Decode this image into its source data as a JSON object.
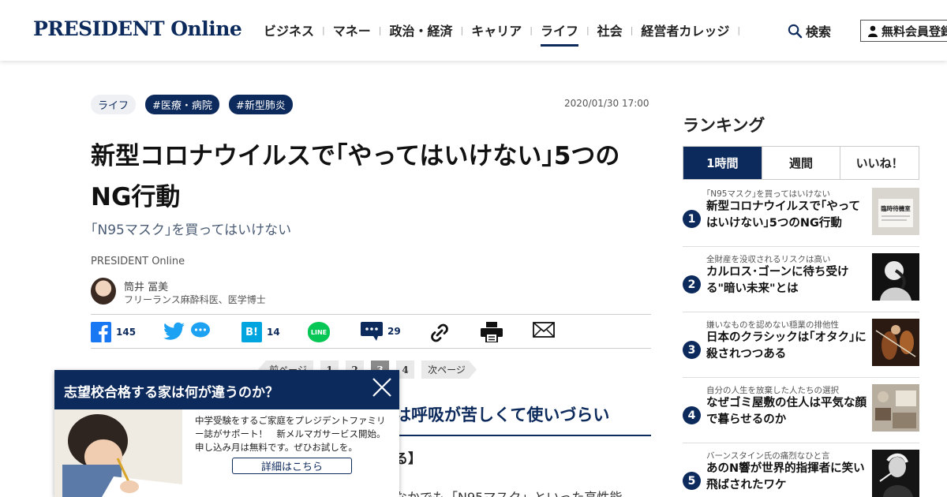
{
  "header": {
    "logo": "PRESIDENT Online",
    "nav": [
      "ビジネス",
      "マネー",
      "政治・経済",
      "キャリア",
      "ライフ",
      "社会",
      "経営者カレッジ"
    ],
    "nav_active": "ライフ",
    "search_label": "検索",
    "member_label": "無料会員登録"
  },
  "article": {
    "tags": [
      "ライフ",
      "#医療・病院",
      "#新型肺炎"
    ],
    "date": "2020/01/30 17:00",
    "title": "新型コロナウイルスで｢やってはいけない｣5つのNG行動",
    "subtitle": "｢N95マスク｣を買ってはいけない",
    "source": "PRESIDENT Online",
    "author_name": "筒井 冨美",
    "author_role": "フリーランス麻酔科医、医学博士",
    "share": {
      "facebook_count": "145",
      "hatena_count": "14",
      "comment_count": "29",
      "hatena_label": "B!",
      "line_label": "LINE"
    },
    "pager": {
      "prev": "前ページ",
      "pages": [
        "1",
        "2",
        "3",
        "4"
      ],
      "current": "3",
      "next": "次ページ"
    },
    "section_heading_visible": "は呼吸が苦しくて使いづらい",
    "sub_heading_visible": "る】",
    "body_snippet_visible": "なかでも「N95マスク」といった高性能"
  },
  "popup": {
    "title": "志望校合格する家は何が違うのか？",
    "text": "中学受験をするご家庭をプレジデントファミリー誌がサポート！　新メルマガサービス開始。申し込み月は無料です。ぜひお試しを。",
    "button": "詳細はこちら"
  },
  "ranking": {
    "title": "ランキング",
    "tabs": [
      "1時間",
      "週間",
      "いいね！"
    ],
    "active_tab": "1時間",
    "items": [
      {
        "rank": "1",
        "kicker": "｢N95マスク｣を買ってはいけない",
        "headline": "新型コロナウイルスで｢やってはいけない｣5つのNG行動",
        "thumb_text": "臨時待機室"
      },
      {
        "rank": "2",
        "kicker": "全財産を没収されるリスクは高い",
        "headline": "カルロス･ゴーンに待ち受ける\"暗い未来\"とは"
      },
      {
        "rank": "3",
        "kicker": "嫌いなものを認めない穏業の排他性",
        "headline": "日本のクラシックは｢オタク｣に殺されつつある"
      },
      {
        "rank": "4",
        "kicker": "自分の人生を放棄した人たちの選択",
        "headline": "なぜゴミ屋敷の住人は平気な顔で暮らせるのか"
      },
      {
        "rank": "5",
        "kicker": "バーンスタイン氏の痛烈なひと言",
        "headline": "あのN響が世界的指揮者に笑い飛ばされたワケ"
      }
    ]
  },
  "colors": {
    "brand_navy": "#0d2a5c",
    "line_green": "#06c755",
    "facebook_blue": "#1877f2",
    "twitter_blue": "#1da1f2"
  }
}
